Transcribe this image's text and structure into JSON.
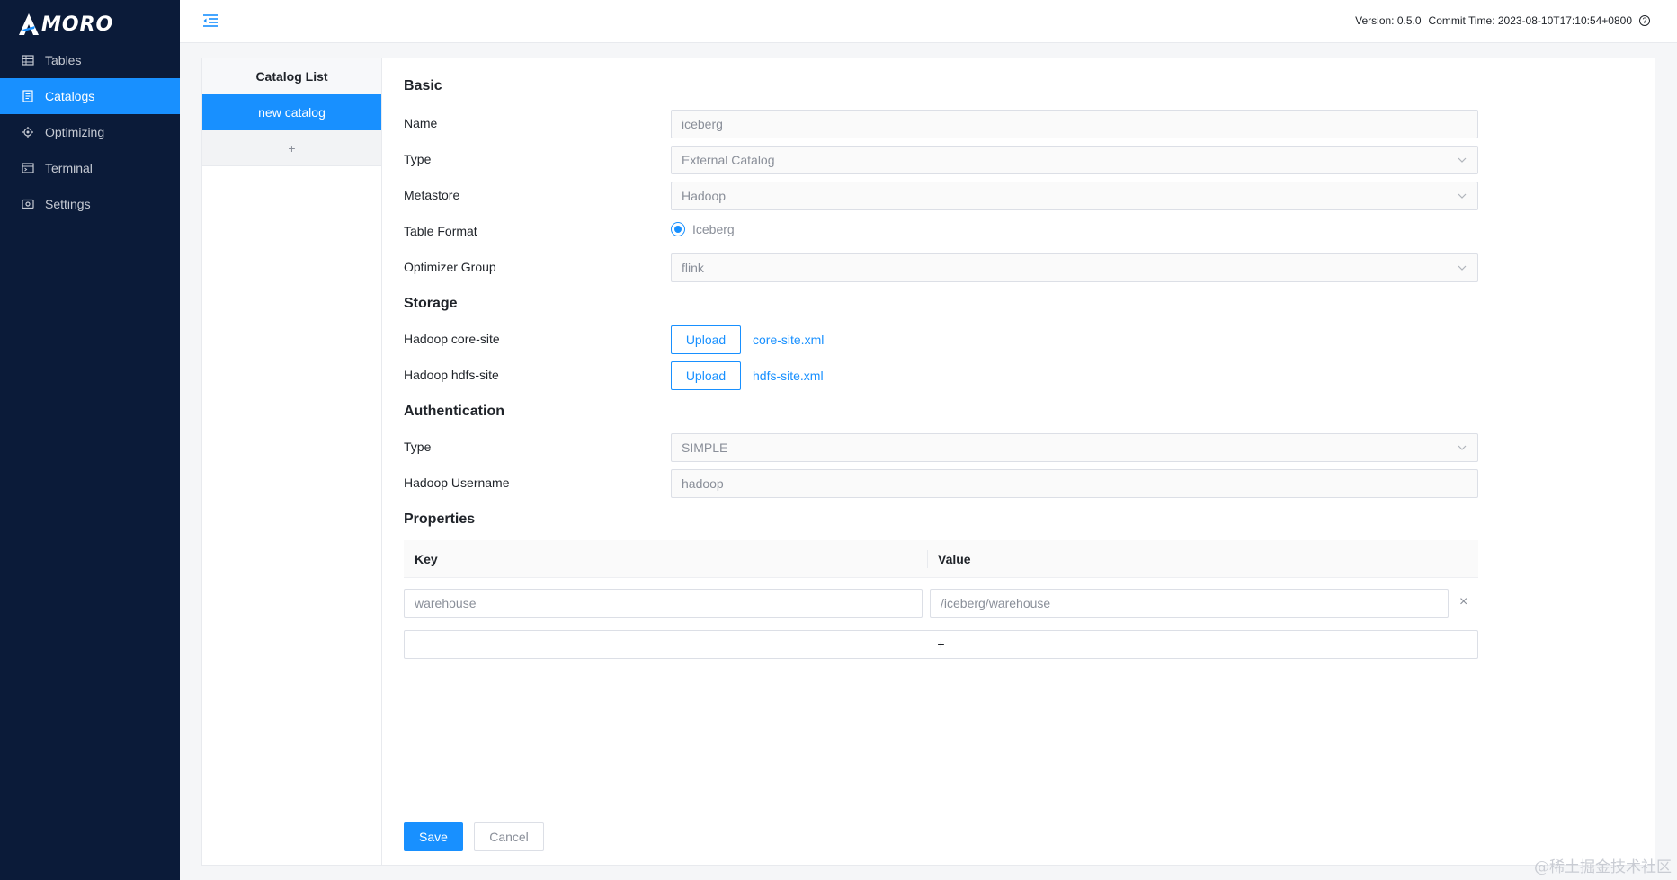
{
  "app": {
    "logo_text": "MORO",
    "logo_icon": "amoro-logo"
  },
  "sidebar": {
    "items": [
      {
        "label": "Tables",
        "icon": "table-icon",
        "active": false
      },
      {
        "label": "Catalogs",
        "icon": "catalog-icon",
        "active": true
      },
      {
        "label": "Optimizing",
        "icon": "optimizing-icon",
        "active": false
      },
      {
        "label": "Terminal",
        "icon": "terminal-icon",
        "active": false
      },
      {
        "label": "Settings",
        "icon": "settings-icon",
        "active": false
      }
    ]
  },
  "header": {
    "version": "Version: 0.5.0",
    "commit_time": "Commit Time: 2023-08-10T17:10:54+0800",
    "help_icon": "?"
  },
  "catalog_list": {
    "title": "Catalog List",
    "items": [
      {
        "label": "new catalog",
        "active": true
      }
    ],
    "add_label": "+"
  },
  "form": {
    "basic": {
      "title": "Basic",
      "name_label": "Name",
      "name_value": "iceberg",
      "type_label": "Type",
      "type_value": "External Catalog",
      "metastore_label": "Metastore",
      "metastore_value": "Hadoop",
      "table_format_label": "Table Format",
      "table_format_value": "Iceberg",
      "optimizer_group_label": "Optimizer Group",
      "optimizer_group_value": "flink"
    },
    "storage": {
      "title": "Storage",
      "core_site_label": "Hadoop core-site",
      "core_site_button": "Upload",
      "core_site_file": "core-site.xml",
      "hdfs_site_label": "Hadoop hdfs-site",
      "hdfs_site_button": "Upload",
      "hdfs_site_file": "hdfs-site.xml"
    },
    "authentication": {
      "title": "Authentication",
      "type_label": "Type",
      "type_value": "SIMPLE",
      "username_label": "Hadoop Username",
      "username_value": "hadoop"
    },
    "properties": {
      "title": "Properties",
      "key_header": "Key",
      "value_header": "Value",
      "rows": [
        {
          "key": "warehouse",
          "value": "/iceberg/warehouse",
          "remove": "×"
        }
      ],
      "add_label": "+"
    },
    "actions": {
      "save": "Save",
      "cancel": "Cancel"
    }
  },
  "watermark": "@稀土掘金技术社区",
  "colors": {
    "primary": "#1890ff",
    "sidebar_bg": "#0b1b39"
  }
}
